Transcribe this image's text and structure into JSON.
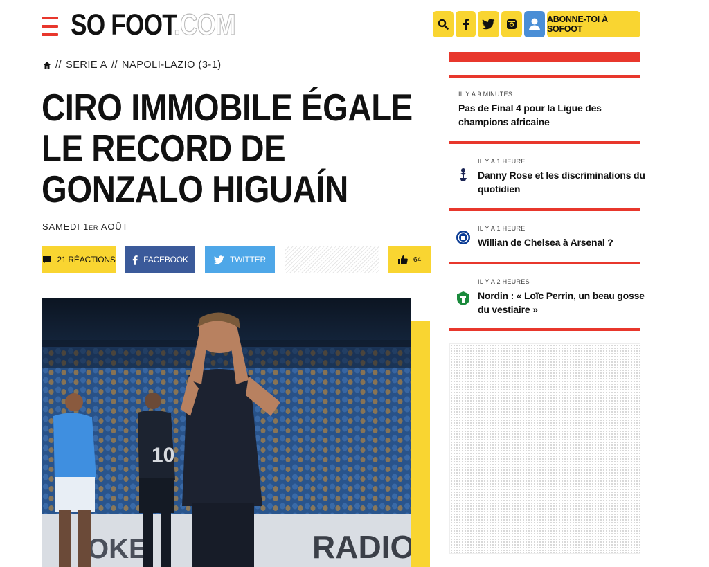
{
  "header": {
    "logo_main": "SO FOOT",
    "logo_suffix": ".COM",
    "subscribe_label": "ABONNE-TOI À SOFOOT",
    "icons": [
      "menu-icon",
      "search-icon",
      "facebook-icon",
      "twitter-icon",
      "instagram-icon",
      "user-icon"
    ],
    "colors": {
      "accent_yellow": "#f9d531",
      "accent_red": "#e8372c",
      "user_blue": "#4a8ed6"
    }
  },
  "breadcrumb": {
    "sep1": "//",
    "league": "SERIE A",
    "sep2": "//",
    "match": "NAPOLI-LAZIO (3-1)"
  },
  "article": {
    "title": "CIRO IMMOBILE ÉGALE LE RECORD DE GONZALO HIGUAÍN",
    "date_prefix": "SAMEDI 1",
    "date_sup": "ER",
    "date_suffix": " AOÛT",
    "actions": {
      "reactions_label": "21 RÉACTIONS",
      "facebook_label": "FACEBOOK",
      "twitter_label": "TWITTER",
      "likes_count": "64"
    },
    "photo": {
      "jersey_number": "10",
      "banner_text": "RADIO",
      "banner_text_left": "OKE"
    }
  },
  "sidebar": {
    "news": [
      {
        "time": "IL Y A 9 MINUTES",
        "headline": "Pas de Final 4 pour la Ligue des champions africaine",
        "badge": ""
      },
      {
        "time": "IL Y A 1 HEURE",
        "headline": "Danny Rose et les discriminations du quotidien",
        "badge": "tottenham-crest-icon"
      },
      {
        "time": "IL Y A 1 HEURE",
        "headline": "Willian de Chelsea à Arsenal ?",
        "badge": "chelsea-crest-icon"
      },
      {
        "time": "IL Y A 2 HEURES",
        "headline": "Nordin : « Loïc Perrin, un beau gosse du vestiaire »",
        "badge": "saint-etienne-crest-icon"
      }
    ]
  }
}
